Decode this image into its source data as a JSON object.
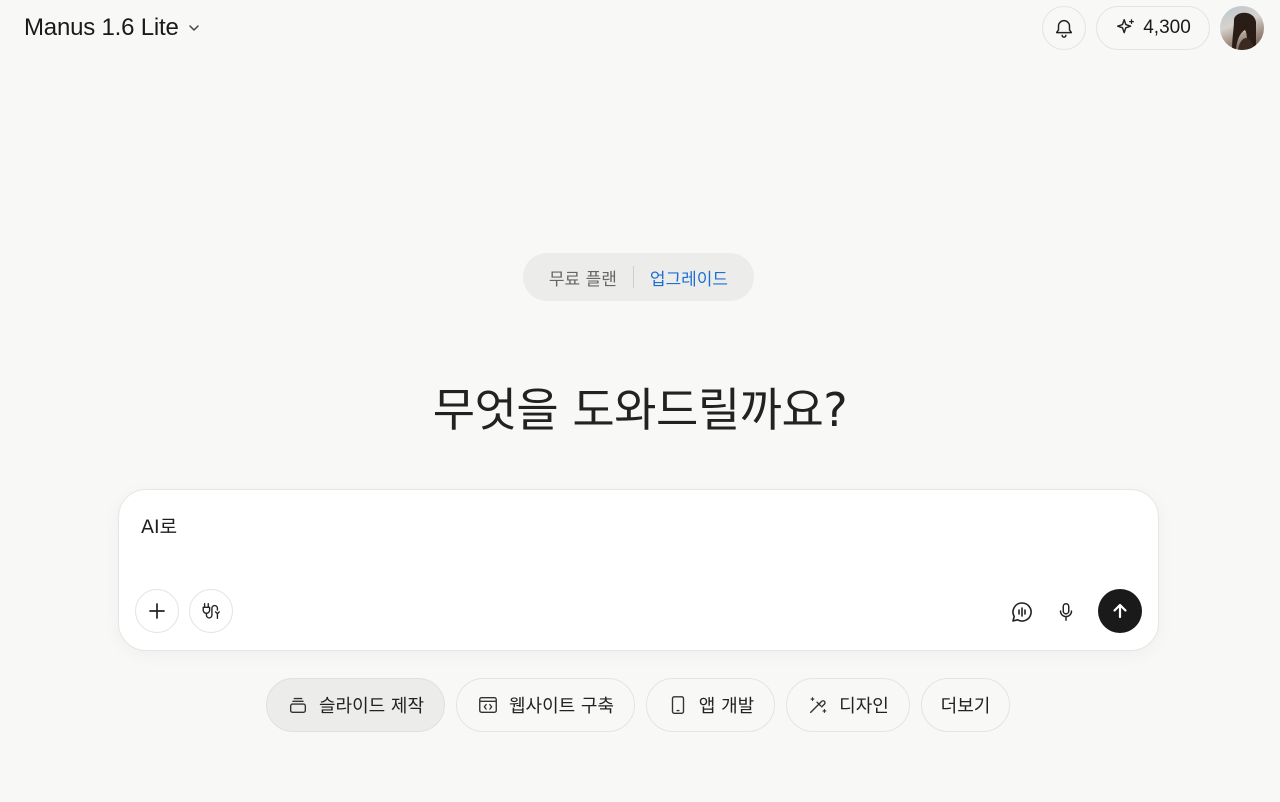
{
  "header": {
    "model_name": "Manus 1.6 Lite",
    "credits": "4,300"
  },
  "plan": {
    "label": "무료 플랜",
    "upgrade_label": "업그레이드"
  },
  "hero": {
    "title": "무엇을 도와드릴까요?"
  },
  "composer": {
    "value": "AI로",
    "placeholder": ""
  },
  "chips": [
    {
      "label": "슬라이드 제작",
      "icon": "slides-icon"
    },
    {
      "label": "웹사이트 구축",
      "icon": "website-icon"
    },
    {
      "label": "앱 개발",
      "icon": "phone-icon"
    },
    {
      "label": "디자인",
      "icon": "design-icon"
    },
    {
      "label": "더보기"
    }
  ],
  "colors": {
    "background": "#f8f8f7",
    "accent_link": "#1f6fd1",
    "send_button": "#1a1a1a"
  }
}
